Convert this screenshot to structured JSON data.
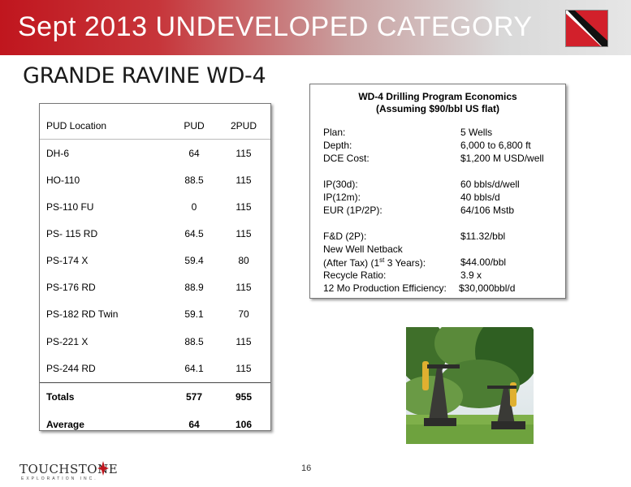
{
  "banner": {
    "title": "Sept 2013 UNDEVELOPED CATEGORY"
  },
  "subtitle": "GRANDE RAVINE WD-4",
  "pud_table": {
    "headers": [
      "PUD Location",
      "PUD",
      "2PUD"
    ],
    "rows": [
      [
        "DH-6",
        "64",
        "115"
      ],
      [
        "HO-110",
        "88.5",
        "115"
      ],
      [
        "PS-110 FU",
        "0",
        "115"
      ],
      [
        "PS- 115 RD",
        "64.5",
        "115"
      ],
      [
        "PS-174 X",
        "59.4",
        "80"
      ],
      [
        "PS-176 RD",
        "88.9",
        "115"
      ],
      [
        "PS-182 RD Twin",
        "59.1",
        "70"
      ],
      [
        "PS-221 X",
        "88.5",
        "115"
      ],
      [
        "PS-244 RD",
        "64.1",
        "115"
      ]
    ],
    "totals": [
      "Totals",
      "577",
      "955"
    ],
    "average": [
      "Average",
      "64",
      "106"
    ]
  },
  "economics": {
    "title_line1": "WD-4 Drilling Program Economics",
    "title_line2": "(Assuming $90/bbl US flat)",
    "plan_label": "Plan:",
    "plan_value": "5 Wells",
    "depth_label": "Depth:",
    "depth_value": "6,000 to 6,800 ft",
    "dce_label": "DCE Cost:",
    "dce_value": "$1,200 M USD/well",
    "ip30_label": "IP(30d):",
    "ip30_value": "60 bbls/d/well",
    "ip12_label": "IP(12m):",
    "ip12_value": "40 bbls/d",
    "eur_label": "EUR (1P/2P):",
    "eur_value": "64/106 Mstb",
    "fd_label": "F&D (2P):",
    "fd_value": "$11.32/bbl",
    "netback_label": "New Well Netback",
    "aftertax_label_a": " (After Tax) (1",
    "aftertax_sup": "st",
    "aftertax_label_b": " 3 Years):",
    "aftertax_value": "$44.00/bbl",
    "recycle_label": "Recycle Ratio:",
    "recycle_value": "3.9 x",
    "prodeff_label": "12 Mo Production Efficiency:",
    "prodeff_value": "$30,000bbl/d"
  },
  "footer": {
    "logo_text": "TOUCHSTONE",
    "logo_sub": "EXPLORATION INC.",
    "page_number": "16"
  },
  "colors": {
    "banner_red": "#c0161e",
    "flag_red": "#d2202b"
  }
}
